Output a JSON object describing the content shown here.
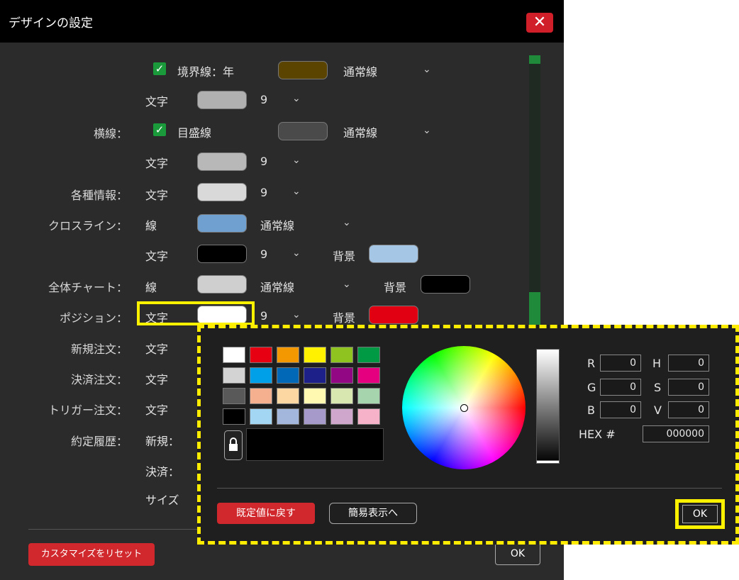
{
  "window": {
    "title": "デザインの設定",
    "close_icon": "close-icon"
  },
  "rows": {
    "border_year": {
      "label": "境界線：年",
      "style": "通常線",
      "color": "#5a4400"
    },
    "border_year_text": {
      "label": "文字",
      "size": "9",
      "color": "#b0b0b0"
    },
    "horizontal": {
      "section": "横線：",
      "label": "目盛線",
      "style": "通常線",
      "color": "#4a4a4a"
    },
    "horizontal_text": {
      "label": "文字",
      "size": "9",
      "color": "#b8b8b8"
    },
    "info": {
      "section": "各種情報：",
      "label": "文字",
      "size": "9",
      "color": "#d9d9d9"
    },
    "crossline": {
      "section": "クロスライン：",
      "label": "線",
      "style": "通常線",
      "color": "#6fa0d0"
    },
    "crossline_text": {
      "label": "文字",
      "size": "9",
      "bg_label": "背景",
      "color": "#000000",
      "bg_color": "#a6c6e6"
    },
    "whole_chart": {
      "section": "全体チャート：",
      "label": "線",
      "style": "通常線",
      "bg_label": "背景",
      "color": "#cfcfcf",
      "bg_color": "#000000"
    },
    "position": {
      "section": "ポジション：",
      "label": "文字",
      "size": "9",
      "bg_label": "背景",
      "color": "#ffffff",
      "bg_color": "#e00012"
    },
    "new_order": {
      "section": "新規注文：",
      "label": "文字"
    },
    "settle_order": {
      "section": "決済注文：",
      "label": "文字"
    },
    "trigger_order": {
      "section": "トリガー注文：",
      "label": "文字"
    },
    "execution_history": {
      "section": "約定履歴：",
      "label": "新規："
    },
    "settle": {
      "label": "決済："
    },
    "size": {
      "label": "サイズ"
    }
  },
  "buttons": {
    "reset": "カスタマイズをリセット",
    "ok": "OK"
  },
  "picker": {
    "palette": [
      [
        "#ffffff",
        "#e60012",
        "#f39800",
        "#fff100",
        "#8fc31f",
        "#009944"
      ],
      [
        "#d3d3d3",
        "#00a0e9",
        "#0068b7",
        "#1d2088",
        "#920783",
        "#e4007f"
      ],
      [
        "#595959",
        "#f5b090",
        "#fcd7a1",
        "#fff9b1",
        "#d7e7af",
        "#a5d4ad"
      ],
      [
        "#000000",
        "#a3d6f2",
        "#a3b7dd",
        "#a59aca",
        "#cfa7cd",
        "#f5b2c8"
      ]
    ],
    "lock_icon": "lock-icon",
    "preview_color": "#000000",
    "channels": {
      "r": {
        "label": "R",
        "value": "0"
      },
      "g": {
        "label": "G",
        "value": "0"
      },
      "b": {
        "label": "B",
        "value": "0"
      },
      "h": {
        "label": "H",
        "value": "0"
      },
      "s": {
        "label": "S",
        "value": "0"
      },
      "v": {
        "label": "V",
        "value": "0"
      }
    },
    "hex": {
      "label": "HEX #",
      "value": "000000"
    },
    "default_button": "既定値に戻す",
    "simple_button": "簡易表示へ",
    "ok_button": "OK"
  }
}
